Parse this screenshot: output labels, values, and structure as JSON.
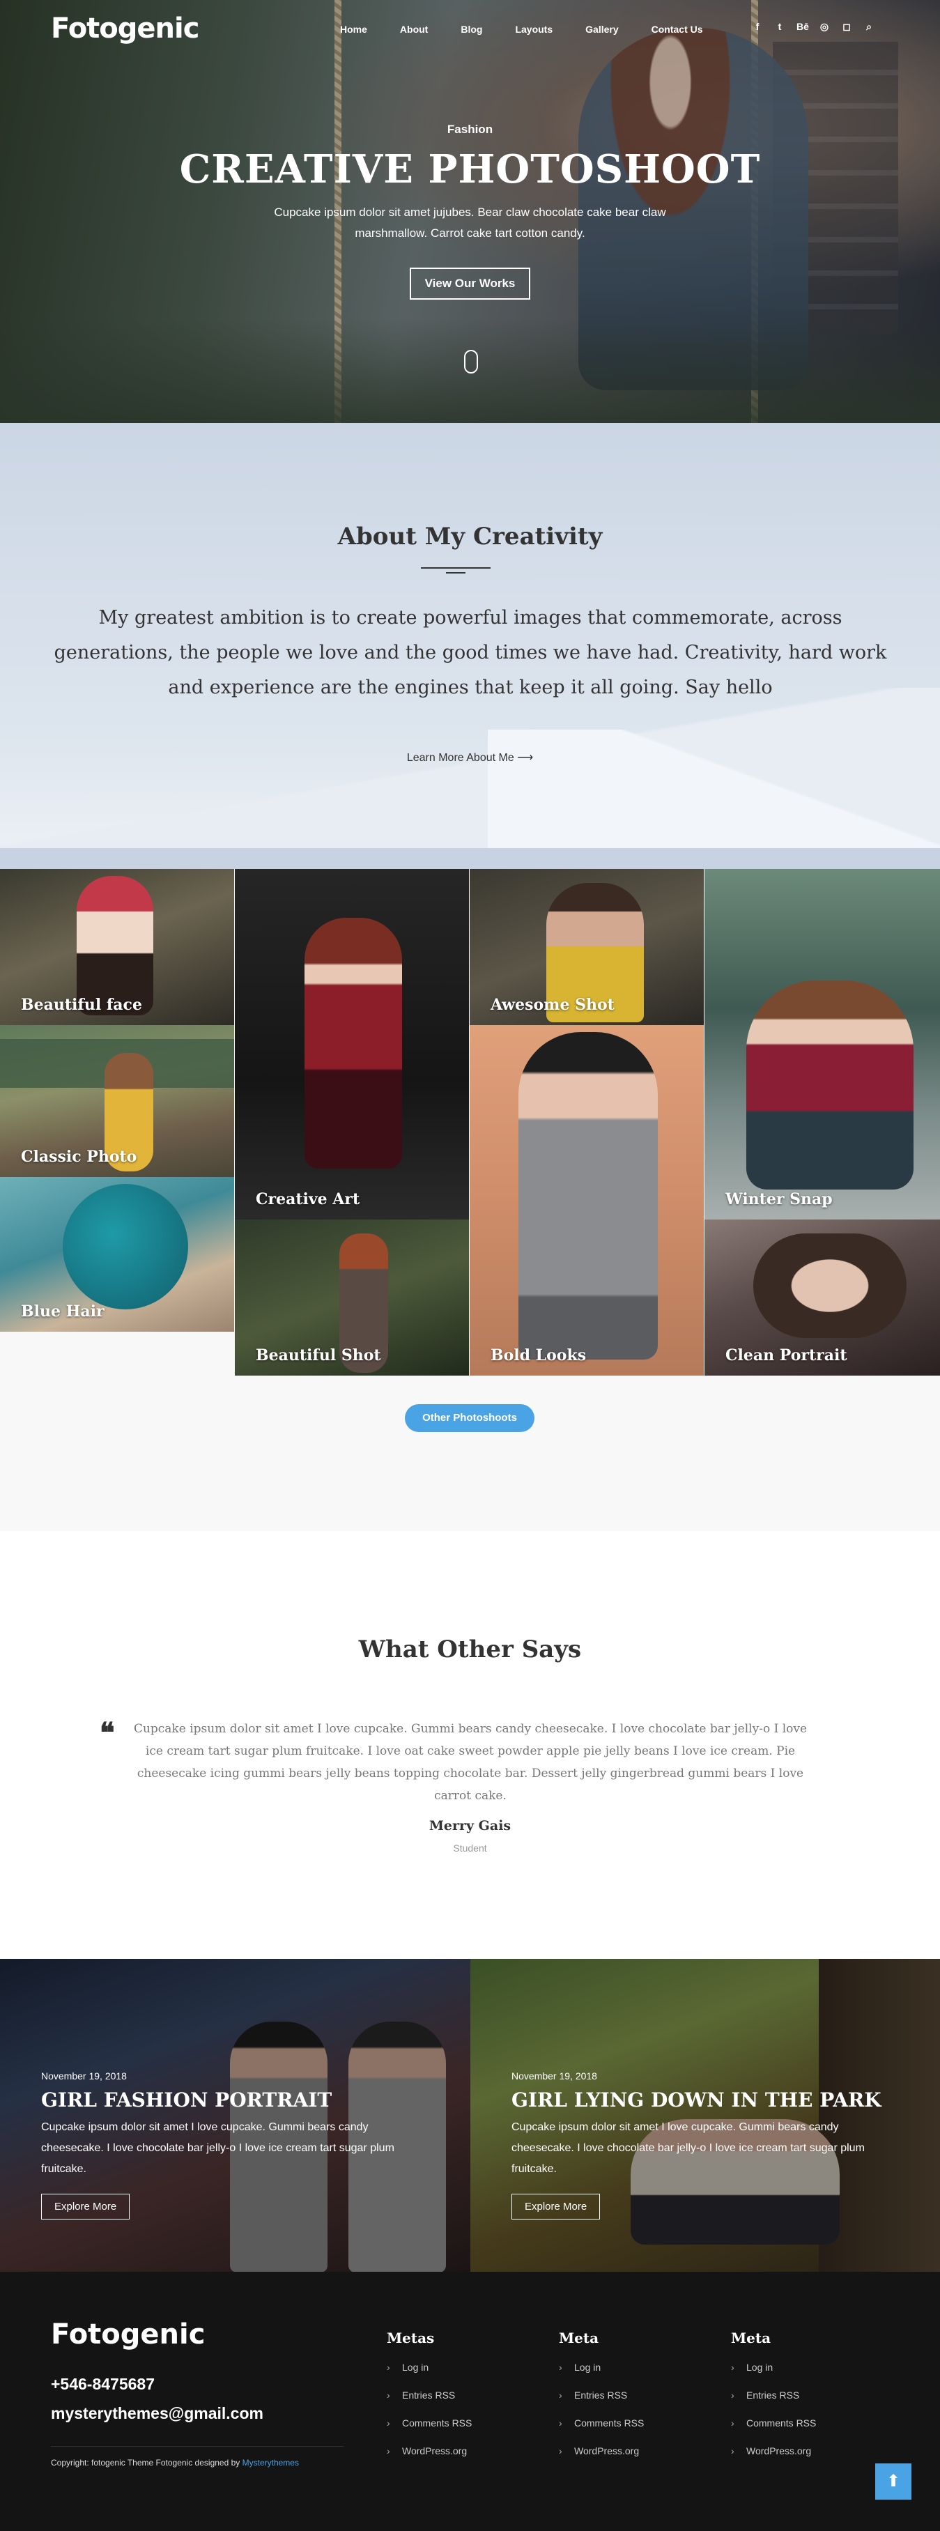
{
  "site": {
    "logo": "Fotogenic"
  },
  "nav": [
    "Home",
    "About",
    "Blog",
    "Layouts",
    "Gallery",
    "Contact Us"
  ],
  "social_icons": [
    "facebook-icon",
    "twitter-icon",
    "behance-icon",
    "github-icon",
    "instagram-icon",
    "search-icon"
  ],
  "social_glyphs": [
    "f",
    "t",
    "Bē",
    "◎",
    "◻",
    "⌕"
  ],
  "hero": {
    "category": "Fashion",
    "title": "CREATIVE PHOTOSHOOT",
    "description": "Cupcake ipsum dolor sit amet jujubes. Bear claw chocolate cake bear claw marshmallow. Carrot cake tart cotton candy.",
    "button": "View Our Works"
  },
  "about": {
    "title": "About My Creativity",
    "text": "My greatest ambition is to create powerful images that commemorate, across generations, the people we love and the good times we have had. Creativity, hard work and experience are the engines that keep it all going. Say hello",
    "link": "Learn More About Me",
    "link_arrow": "⟶"
  },
  "gallery": {
    "items": [
      "Beautiful face",
      "Classic Photo",
      "Blue Hair",
      "Creative Art",
      "Beautiful Shot",
      "Awesome Shot",
      "Bold Looks",
      "Winter Snap",
      "Clean Portrait"
    ],
    "button": "Other Photoshoots"
  },
  "testimonial": {
    "title": "What Other Says",
    "quote": "Cupcake ipsum dolor sit amet I love cupcake. Gummi bears candy cheesecake. I love chocolate bar jelly-o I love ice cream tart sugar plum fruitcake. I love oat cake sweet powder apple pie jelly beans I love ice cream. Pie cheesecake icing gummi bears jelly beans topping chocolate bar. Dessert jelly gingerbread gummi bears I love carrot cake.",
    "name": "Merry Gais",
    "role": "Student"
  },
  "featured": [
    {
      "date": "November 19, 2018",
      "title": "GIRL FASHION PORTRAIT",
      "excerpt": "Cupcake ipsum dolor sit amet I love cupcake. Gummi bears candy cheesecake. I love chocolate bar jelly-o I love ice cream tart sugar plum fruitcake.",
      "button": "Explore More"
    },
    {
      "date": "November 19, 2018",
      "title": "GIRL LYING DOWN IN THE PARK",
      "excerpt": "Cupcake ipsum dolor sit amet I love cupcake. Gummi bears candy cheesecake. I love chocolate bar jelly-o I love ice cream tart sugar plum fruitcake.",
      "button": "Explore More"
    }
  ],
  "footer": {
    "logo": "Fotogenic",
    "phone": "+546-8475687",
    "email": "mysterythemes@gmail.com",
    "copyright": "Copyright: fotogenic Theme Fotogenic designed by",
    "copyright_link": "Mysterythemes",
    "columns": [
      {
        "title": "Metas",
        "links": [
          "Log in",
          "Entries RSS",
          "Comments RSS",
          "WordPress.org"
        ]
      },
      {
        "title": "Meta",
        "links": [
          "Log in",
          "Entries RSS",
          "Comments RSS",
          "WordPress.org"
        ]
      },
      {
        "title": "Meta",
        "links": [
          "Log in",
          "Entries RSS",
          "Comments RSS",
          "WordPress.org"
        ]
      }
    ],
    "chevron": "›",
    "to_top": "⬆"
  },
  "colors": {
    "accent": "#4aa3e4",
    "footer_bg": "#141414"
  }
}
